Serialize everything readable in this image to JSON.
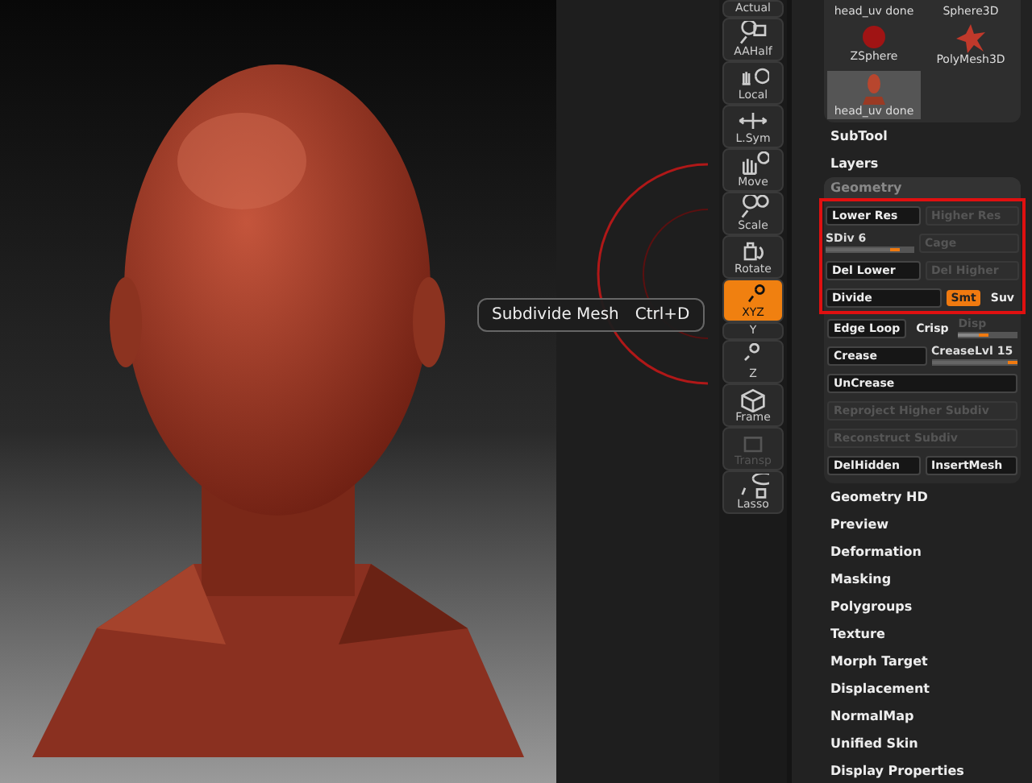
{
  "tooltip": {
    "title": "Subdivide Mesh",
    "shortcut": "Ctrl+D"
  },
  "shelf": [
    {
      "label": "Actual",
      "selected": false,
      "disabled": false
    },
    {
      "label": "AAHalf",
      "selected": false,
      "disabled": false
    },
    {
      "label": "Local",
      "selected": false,
      "disabled": false
    },
    {
      "label": "L.Sym",
      "selected": false,
      "disabled": false
    },
    {
      "label": "Move",
      "selected": false,
      "disabled": false
    },
    {
      "label": "Scale",
      "selected": false,
      "disabled": false
    },
    {
      "label": "Rotate",
      "selected": false,
      "disabled": false
    },
    {
      "label": "XYZ",
      "selected": true,
      "disabled": false
    },
    {
      "label": "Y",
      "selected": false,
      "disabled": false
    },
    {
      "label": "Z",
      "selected": false,
      "disabled": false
    },
    {
      "label": "Frame",
      "selected": false,
      "disabled": false
    },
    {
      "label": "Transp",
      "selected": false,
      "disabled": true
    },
    {
      "label": "Lasso",
      "selected": false,
      "disabled": false
    }
  ],
  "tools": [
    {
      "kind": "label-only",
      "label": "head_uv done",
      "selected": false
    },
    {
      "kind": "label-only",
      "label": "Sphere3D",
      "selected": false
    },
    {
      "kind": "sphere",
      "label": "ZSphere",
      "selected": false
    },
    {
      "kind": "star",
      "label": "PolyMesh3D",
      "selected": false
    },
    {
      "kind": "bust",
      "label": "head_uv done",
      "selected": true
    }
  ],
  "palettes_before": [
    "SubTool",
    "Layers"
  ],
  "geometry": {
    "title": "Geometry",
    "expanded": true,
    "rows": [
      {
        "highlighted": true,
        "controls": [
          {
            "kind": "button",
            "label": "Lower Res",
            "disabled": false
          },
          {
            "kind": "button",
            "label": "Higher Res",
            "disabled": true
          }
        ]
      },
      {
        "highlighted": true,
        "controls": [
          {
            "kind": "slider",
            "label": "SDiv 6",
            "level": 0.85,
            "disabled": false
          },
          {
            "kind": "button",
            "label": "Cage",
            "disabled": true
          }
        ]
      },
      {
        "highlighted": true,
        "controls": [
          {
            "kind": "button",
            "label": "Del Lower",
            "disabled": false
          },
          {
            "kind": "button",
            "label": "Del Higher",
            "disabled": true
          }
        ]
      },
      {
        "highlighted": true,
        "controls": [
          {
            "kind": "button",
            "label": "Divide",
            "disabled": false
          },
          {
            "kind": "toggle",
            "label": "Smt",
            "on": true
          },
          {
            "kind": "toggle",
            "label": "Suv",
            "on": false
          }
        ]
      },
      {
        "highlighted": false,
        "controls": [
          {
            "kind": "button",
            "label": "Edge Loop",
            "disabled": false
          },
          {
            "kind": "toggle",
            "label": "Crisp",
            "on": false
          },
          {
            "kind": "slider",
            "label": "Disp",
            "level": 0.5,
            "disabled": true
          }
        ]
      },
      {
        "highlighted": false,
        "controls": [
          {
            "kind": "button",
            "label": "Crease",
            "disabled": false
          },
          {
            "kind": "slider",
            "label": "CreaseLvl 15",
            "level": 1,
            "disabled": false
          }
        ]
      },
      {
        "highlighted": false,
        "controls": [
          {
            "kind": "button",
            "label": "UnCrease",
            "disabled": false
          }
        ]
      },
      {
        "highlighted": false,
        "controls": [
          {
            "kind": "button",
            "label": "Reproject Higher Subdiv",
            "disabled": true
          }
        ]
      },
      {
        "highlighted": false,
        "controls": [
          {
            "kind": "button",
            "label": "Reconstruct Subdiv",
            "disabled": true
          }
        ]
      },
      {
        "highlighted": false,
        "controls": [
          {
            "kind": "button",
            "label": "DelHidden",
            "disabled": false
          },
          {
            "kind": "button",
            "label": "InsertMesh",
            "disabled": false
          }
        ]
      }
    ]
  },
  "palettes_after": [
    "Geometry HD",
    "Preview",
    "Deformation",
    "Masking",
    "Polygroups",
    "Texture",
    "Morph Target",
    "Displacement",
    "NormalMap",
    "Unified Skin",
    "Display Properties"
  ]
}
